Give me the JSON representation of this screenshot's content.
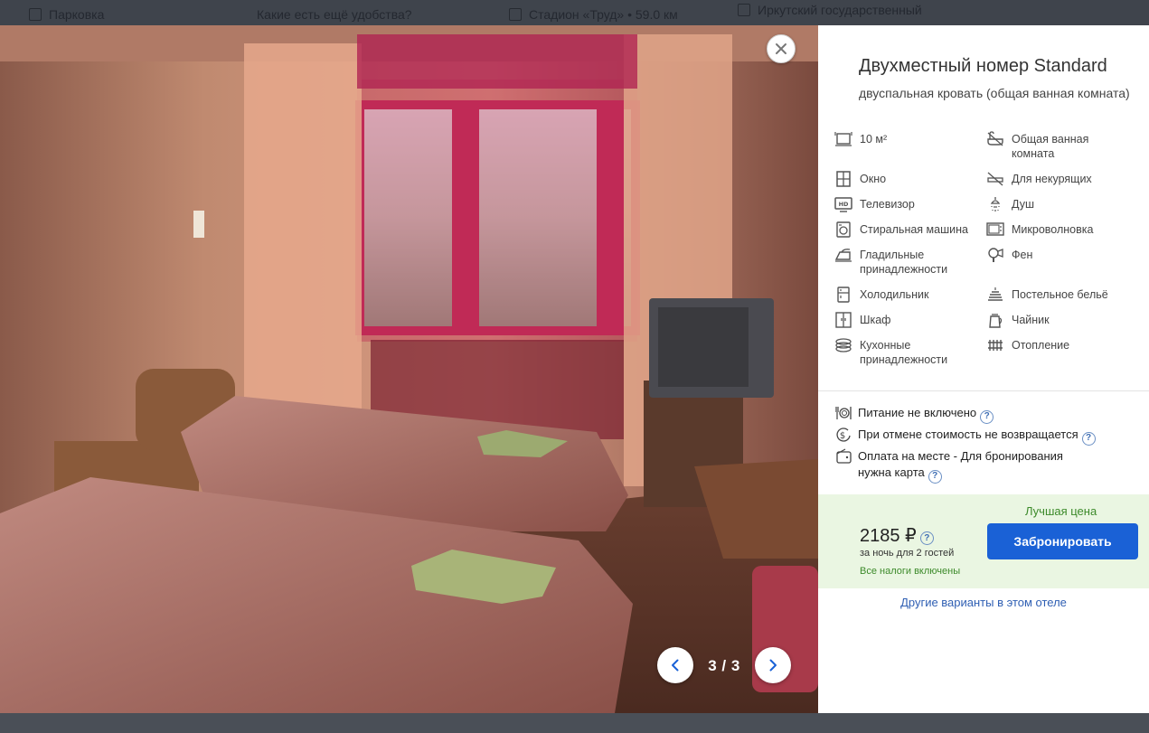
{
  "background_page": {
    "items": [
      {
        "label": "Парковка",
        "icon": "parking-icon"
      },
      {
        "label": "Какие есть ещё удобства?",
        "icon": ""
      },
      {
        "label": "Стадион «Труд» • 59.0 км",
        "icon": "stadium-icon"
      },
      {
        "label": "Иркутский государственный",
        "icon": "university-icon"
      }
    ]
  },
  "gallery": {
    "counter": "3 / 3",
    "current": 3,
    "total": 3
  },
  "room": {
    "title": "Двухместный номер Standard",
    "subtitle": "двуспальная кровать (общая ванная комната)"
  },
  "amenities": [
    {
      "label": "10 м²",
      "icon": "area-icon"
    },
    {
      "label": "Общая ванная комната",
      "icon": "bathtub-icon"
    },
    {
      "label": "Окно",
      "icon": "window-icon"
    },
    {
      "label": "Для некурящих",
      "icon": "no-smoking-icon"
    },
    {
      "label": "Телевизор",
      "icon": "tv-icon"
    },
    {
      "label": "Душ",
      "icon": "shower-icon"
    },
    {
      "label": "Стиральная машина",
      "icon": "washing-machine-icon"
    },
    {
      "label": "Микроволновка",
      "icon": "microwave-icon"
    },
    {
      "label": "Гладильные принадлежности",
      "icon": "iron-icon"
    },
    {
      "label": "Фен",
      "icon": "hairdryer-icon"
    },
    {
      "label": "Холодильник",
      "icon": "fridge-icon"
    },
    {
      "label": "Постельное бельё",
      "icon": "bed-linen-icon"
    },
    {
      "label": "Шкаф",
      "icon": "wardrobe-icon"
    },
    {
      "label": "Чайник",
      "icon": "kettle-icon"
    },
    {
      "label": "Кухонные принадлежности",
      "icon": "kitchenware-icon"
    },
    {
      "label": "Отопление",
      "icon": "heating-icon"
    }
  ],
  "policies": [
    {
      "label": "Питание не включено",
      "icon": "meal-icon"
    },
    {
      "label": "При отмене стоимость не возвращается",
      "icon": "refund-icon"
    },
    {
      "label": "Оплата на месте - Для бронирования нужна карта",
      "icon": "wallet-icon"
    }
  ],
  "offer": {
    "badge": "Лучшая цена",
    "price": "2185 ₽",
    "per_night": "за ночь для 2 гостей",
    "taxes": "Все налоги включены",
    "book_label": "Забронировать",
    "others_link": "Другие варианты в этом отеле"
  },
  "colors": {
    "accent": "#1a61d6",
    "best_price_bg": "#eaf6e2",
    "best_price_text": "#3c8a2a",
    "link": "#2f5fb3"
  }
}
